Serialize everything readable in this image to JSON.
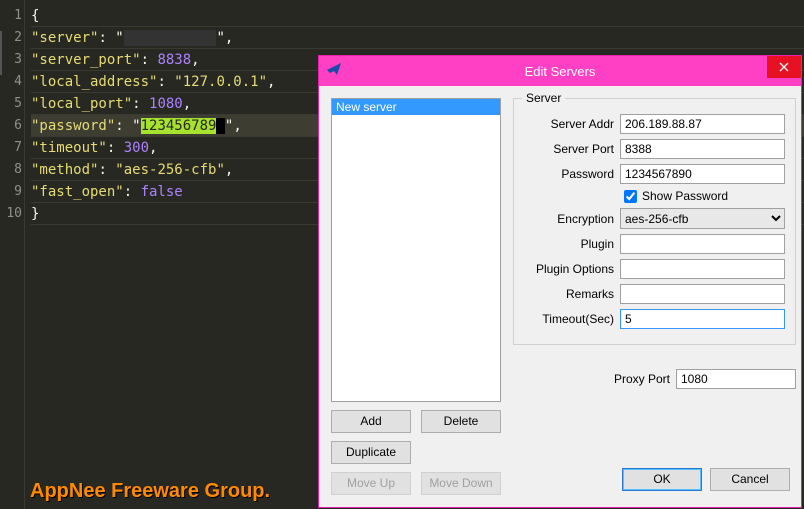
{
  "editor": {
    "lines": [
      "1",
      "2",
      "3",
      "4",
      "5",
      "6",
      "7",
      "8",
      "9",
      "10"
    ],
    "open_brace": "{",
    "k_server": "\"server\"",
    "v_server_redacted": "           ",
    "k_server_port": "\"server_port\"",
    "v_server_port": "8838",
    "k_local_addr": "\"local_address\"",
    "v_local_addr": "\"127.0.0.1\"",
    "k_local_port": "\"local_port\"",
    "v_local_port": "1080",
    "k_password": "\"password\"",
    "v_password_hl": "123456789",
    "k_timeout": "\"timeout\"",
    "v_timeout": "300",
    "k_method": "\"method\"",
    "v_method": "\"aes-256-cfb\"",
    "k_fast_open": "\"fast_open\"",
    "v_fast_open": "false",
    "close_brace": "}"
  },
  "badge": "AppNee Freeware Group.",
  "dialog": {
    "title": "Edit Servers",
    "list": {
      "item0": "New server"
    },
    "buttons": {
      "add": "Add",
      "delete": "Delete",
      "duplicate": "Duplicate",
      "moveup": "Move Up",
      "movedown": "Move Down",
      "ok": "OK",
      "cancel": "Cancel"
    },
    "group": {
      "legend": "Server",
      "server_addr_label": "Server Addr",
      "server_addr_value": "206.189.88.87",
      "server_port_label": "Server Port",
      "server_port_value": "8388",
      "password_label": "Password",
      "password_value": "1234567890",
      "show_password_label": "Show Password",
      "show_password_checked": true,
      "encryption_label": "Encryption",
      "encryption_value": "aes-256-cfb",
      "plugin_label": "Plugin",
      "plugin_value": "",
      "plugin_opts_label": "Plugin Options",
      "plugin_opts_value": "",
      "remarks_label": "Remarks",
      "remarks_value": "",
      "timeout_label": "Timeout(Sec)",
      "timeout_value": "5",
      "proxy_label": "Proxy Port",
      "proxy_value": "1080"
    }
  }
}
